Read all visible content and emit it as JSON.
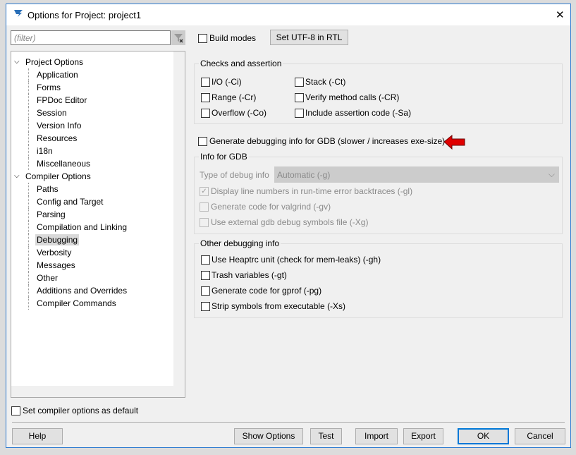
{
  "window": {
    "title": "Options for Project: project1",
    "close": "✕"
  },
  "filter": {
    "placeholder": "(filter)"
  },
  "tree": {
    "groups": [
      {
        "label": "Project Options",
        "items": [
          "Application",
          "Forms",
          "FPDoc Editor",
          "Session",
          "Version Info",
          "Resources",
          "i18n",
          "Miscellaneous"
        ]
      },
      {
        "label": "Compiler Options",
        "items": [
          "Paths",
          "Config and Target",
          "Parsing",
          "Compilation and Linking",
          "Debugging",
          "Verbosity",
          "Messages",
          "Other",
          "Additions and Overrides",
          "Compiler Commands"
        ]
      }
    ],
    "selected": "Debugging"
  },
  "top": {
    "build_modes": "Build modes",
    "set_utf8": "Set UTF-8 in RTL"
  },
  "checks": {
    "title": "Checks and assertion",
    "items": [
      "I/O (-Ci)",
      "Range (-Cr)",
      "Overflow (-Co)",
      "Stack (-Ct)",
      "Verify method calls (-CR)",
      "Include assertion code (-Sa)"
    ]
  },
  "gdb": {
    "generate": "Generate debugging info for GDB (slower / increases exe-size)",
    "title": "Info for GDB",
    "type_label": "Type of debug info",
    "type_value": "Automatic (-g)",
    "line_numbers": "Display line numbers in run-time error backtraces (-gl)",
    "line_numbers_checked": true,
    "valgrind": "Generate code for valgrind (-gv)",
    "external": "Use external gdb debug symbols file (-Xg)"
  },
  "other": {
    "title": "Other debugging info",
    "items": [
      "Use Heaptrc unit (check for mem-leaks) (-gh)",
      "Trash variables (-gt)",
      "Generate code for gprof (-pg)",
      "Strip symbols from executable (-Xs)"
    ]
  },
  "default_cb": "Set compiler options as default",
  "buttons": {
    "help": "Help",
    "show_options": "Show Options",
    "test": "Test",
    "import": "Import",
    "export": "Export",
    "ok": "OK",
    "cancel": "Cancel"
  },
  "colors": {
    "accent": "#0078d7",
    "arrow": "#e00000"
  }
}
